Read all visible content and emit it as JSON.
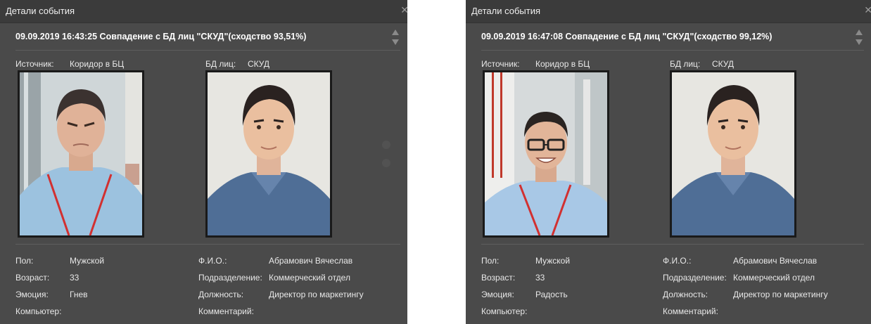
{
  "panels": [
    {
      "window_title": "Детали события",
      "headline": "09.09.2019 16:43:25 Совпадение с БД лиц \"СКУД\"(сходство 93,51%)",
      "source_label": "Источник:",
      "source_value": "Коридор в БЦ",
      "db_label": "БД лиц:",
      "db_value": "СКУД",
      "fields_left": [
        {
          "label": "Пол:",
          "value": "Мужской"
        },
        {
          "label": "Возраст:",
          "value": "33"
        },
        {
          "label": "Эмоция:",
          "value": "Гнев"
        },
        {
          "label": "Компьютер:",
          "value": ""
        }
      ],
      "fields_right": [
        {
          "label": "Ф.И.О.:",
          "value": "Абрамович Вячеслав"
        },
        {
          "label": "Подразделение:",
          "value": "Коммерческий отдел"
        },
        {
          "label": "Должность:",
          "value": "Директор по маркетингу"
        },
        {
          "label": "Комментарий:",
          "value": ""
        }
      ]
    },
    {
      "window_title": "Детали события",
      "headline": "09.09.2019 16:47:08 Совпадение с БД лиц \"СКУД\"(сходство 99,12%)",
      "source_label": "Источник:",
      "source_value": "Коридор в БЦ",
      "db_label": "БД лиц:",
      "db_value": "СКУД",
      "fields_left": [
        {
          "label": "Пол:",
          "value": "Мужской"
        },
        {
          "label": "Возраст:",
          "value": "33"
        },
        {
          "label": "Эмоция:",
          "value": "Радость"
        },
        {
          "label": "Компьютер:",
          "value": ""
        }
      ],
      "fields_right": [
        {
          "label": "Ф.И.О.:",
          "value": "Абрамович Вячеслав"
        },
        {
          "label": "Подразделение:",
          "value": "Коммерческий отдел"
        },
        {
          "label": "Должность:",
          "value": "Директор по маркетингу"
        },
        {
          "label": "Комментарий:",
          "value": ""
        }
      ]
    }
  ],
  "colors": {
    "panel_bg": "#4a4a4a",
    "titlebar_bg": "#3b3b3b",
    "text": "#e8e8e8"
  },
  "icons": [
    "close-icon",
    "scroll-up-icon",
    "scroll-down-icon"
  ]
}
